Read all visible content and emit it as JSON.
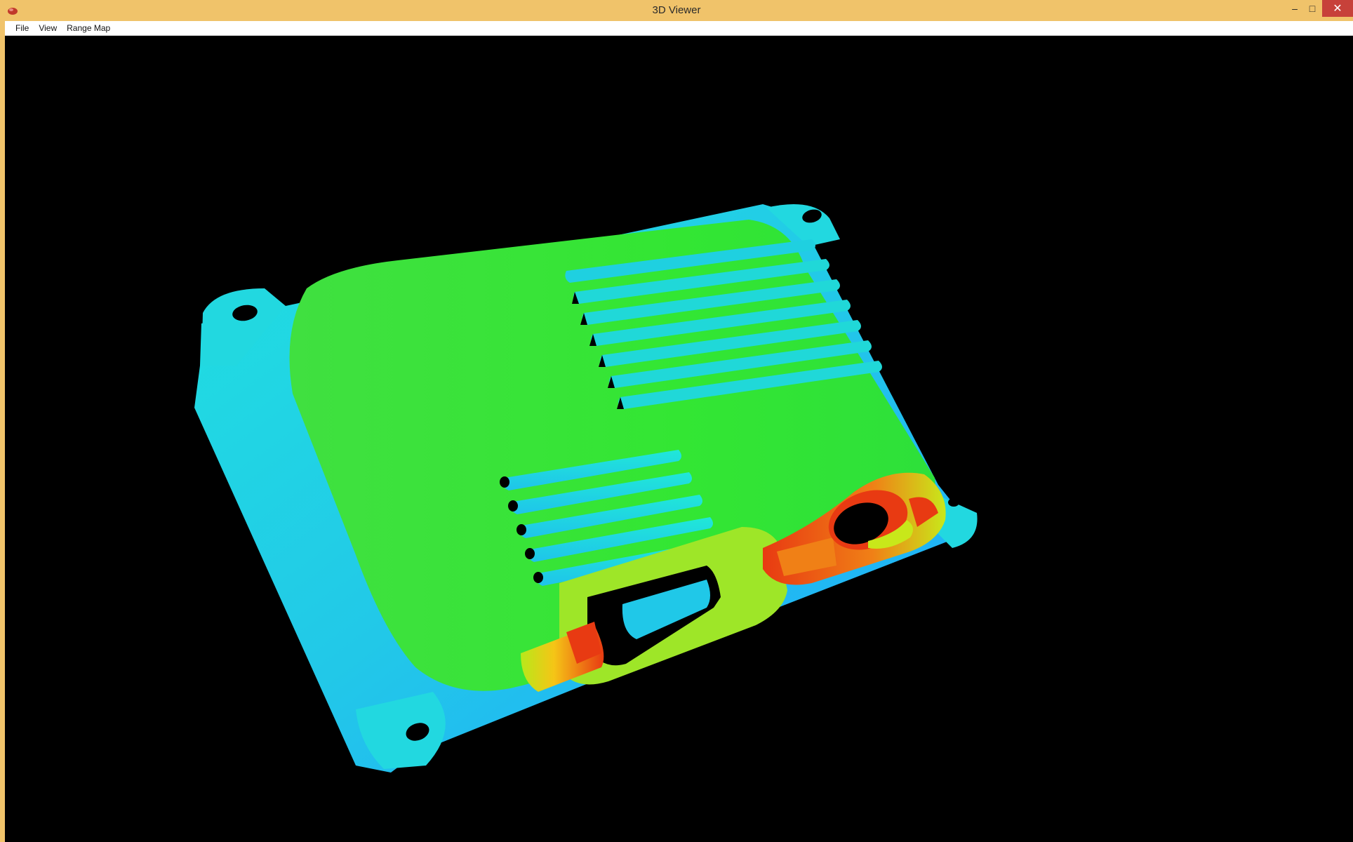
{
  "window": {
    "title": "3D Viewer",
    "controls": {
      "minimize": "–",
      "maximize": "□",
      "close": "✕"
    }
  },
  "menu": {
    "items": [
      "File",
      "View",
      "Range Map"
    ]
  },
  "viewport": {
    "background": "#000000",
    "content": "point-cloud-render",
    "colormap": [
      "#1fb6ff",
      "#20e0e0",
      "#33e633",
      "#b8e81a",
      "#f5c516",
      "#e83a12"
    ]
  },
  "colors": {
    "titlebar": "#f0c36a",
    "close_button": "#c7413a"
  }
}
